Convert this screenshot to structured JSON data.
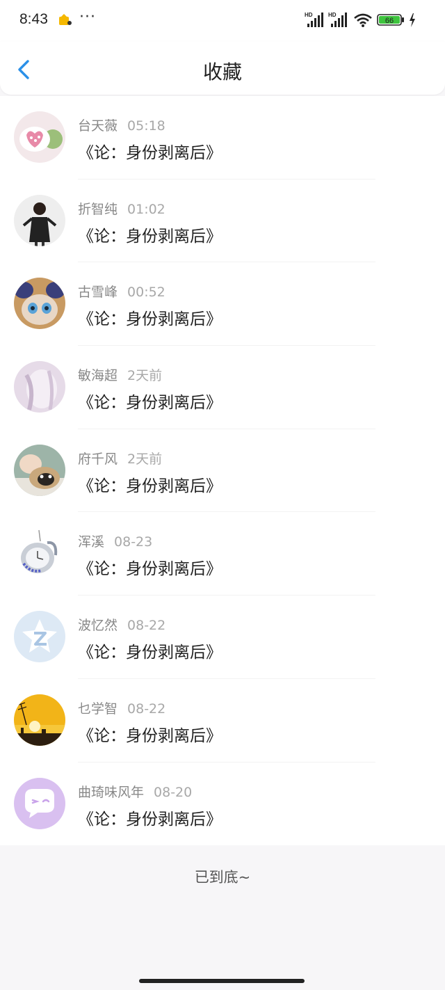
{
  "status_bar": {
    "time": "8:43",
    "battery_level": "66",
    "icons": [
      "app-notification-icon",
      "more-dots-icon",
      "hd-signal-icon",
      "hd-signal-icon",
      "wifi-icon",
      "battery-icon",
      "charging-icon"
    ]
  },
  "header": {
    "title": "收藏",
    "back_icon": "back-arrow-icon"
  },
  "favorites": [
    {
      "name": "台天薇",
      "time": "05:18",
      "title": "《论：身份剥离后》"
    },
    {
      "name": "折智纯",
      "time": "01:02",
      "title": "《论：身份剥离后》"
    },
    {
      "name": "古雪峰",
      "time": "00:52",
      "title": "《论：身份剥离后》"
    },
    {
      "name": "敏海超",
      "time": "2天前",
      "title": "《论：身份剥离后》"
    },
    {
      "name": "府千风",
      "time": "2天前",
      "title": "《论：身份剥离后》"
    },
    {
      "name": "浑溪",
      "time": "08-23",
      "title": "《论：身份剥离后》"
    },
    {
      "name": "波忆然",
      "time": "08-22",
      "title": "《论：身份剥离后》"
    },
    {
      "name": "乜学智",
      "time": "08-22",
      "title": "《论：身份剥离后》"
    },
    {
      "name": "曲琦味风年",
      "time": "08-20",
      "title": "《论：身份剥离后》"
    }
  ],
  "footer": {
    "end_text": "已到底~"
  },
  "colors": {
    "accent": "#2a90e8",
    "battery_fill": "#3ec43e",
    "background": "#f7f6f8"
  }
}
